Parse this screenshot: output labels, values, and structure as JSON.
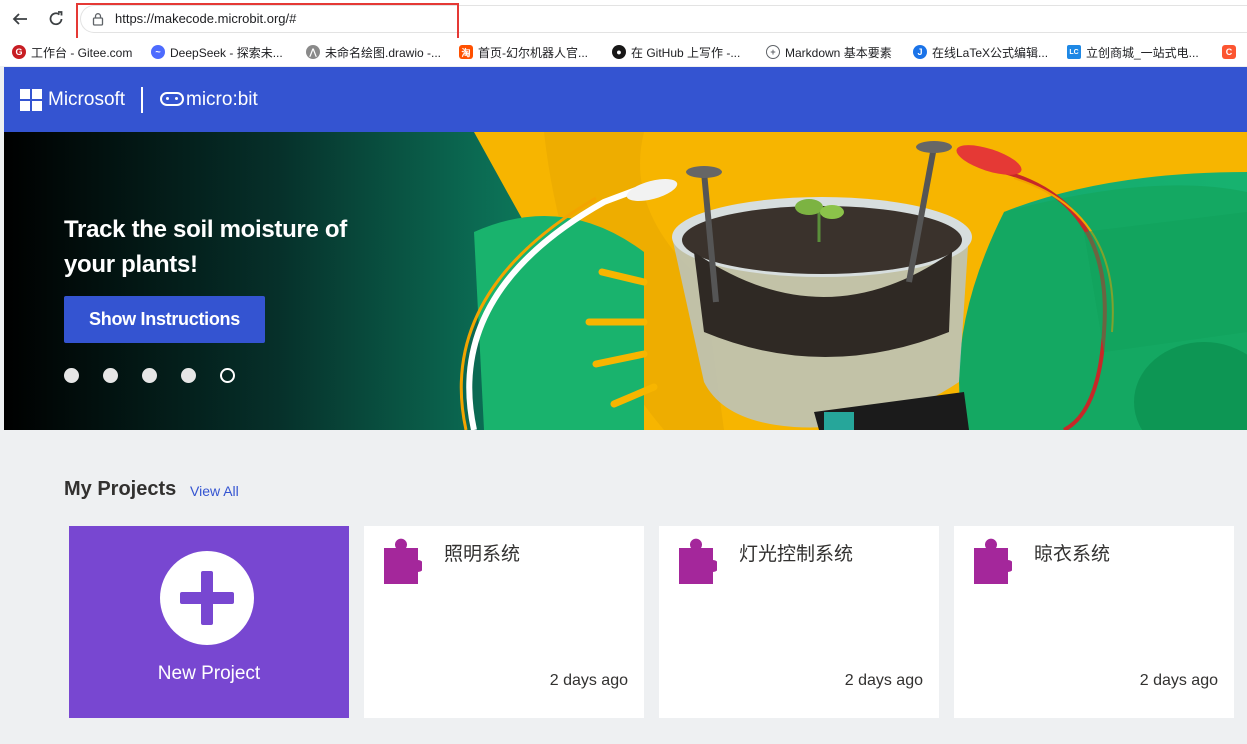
{
  "browser": {
    "url": "https://makecode.microbit.org/#",
    "bookmarks": [
      {
        "label": "工作台 - Gitee.com",
        "icon": "gitee-icon",
        "color": "#c71d23"
      },
      {
        "label": "DeepSeek - 探索未...",
        "icon": "deepseek-icon",
        "color": "#4d6bfe"
      },
      {
        "label": "未命名绘图.drawio -...",
        "icon": "drawio-icon",
        "color": "#8a8a8a"
      },
      {
        "label": "首页-幻尔机器人官...",
        "icon": "taobao-icon",
        "color": "#ff5000"
      },
      {
        "label": "在 GitHub 上写作 -...",
        "icon": "github-icon",
        "color": "#181717"
      },
      {
        "label": "Markdown 基本要素",
        "icon": "globe-icon",
        "color": "#5f6368"
      },
      {
        "label": "在线LaTeX公式编辑...",
        "icon": "latex-icon",
        "color": "#1a73e8"
      },
      {
        "label": "立创商城_一站式电...",
        "icon": "lcsc-icon",
        "color": "#1e88e5"
      },
      {
        "label": "C",
        "icon": "csdn-icon",
        "color": "#fc5531"
      }
    ]
  },
  "header": {
    "microsoft": "Microsoft",
    "microbit": "micro:bit"
  },
  "hero": {
    "title": "Track the soil moisture of your plants!",
    "button": "Show Instructions",
    "slides": 5,
    "active_slide": 5
  },
  "projects": {
    "title": "My Projects",
    "view_all": "View All",
    "new_project": "New Project",
    "items": [
      {
        "name": "照明系统",
        "time": "2 days ago"
      },
      {
        "name": "灯光控制系统",
        "time": "2 days ago"
      },
      {
        "name": "晾衣系统",
        "time": "2 days ago"
      }
    ]
  },
  "colors": {
    "header_blue": "#3454d1",
    "new_project_purple": "#7847d1",
    "puzzle_magenta": "#a4279b"
  }
}
